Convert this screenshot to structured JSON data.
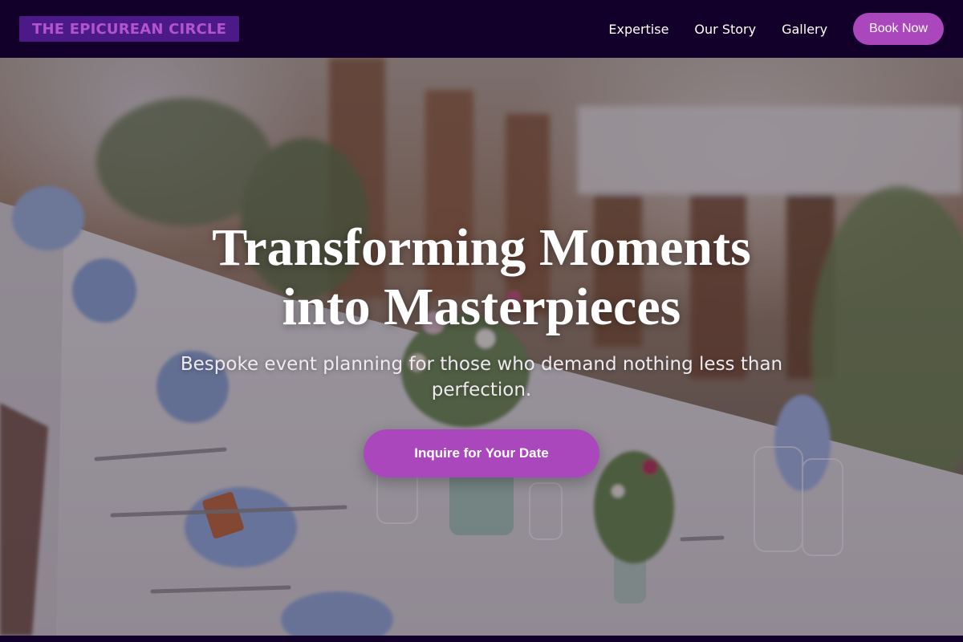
{
  "brand": {
    "name": "THE EPICUREAN CIRCLE"
  },
  "nav": {
    "links": [
      "Expertise",
      "Our Story",
      "Gallery"
    ],
    "cta_label": "Book Now"
  },
  "hero": {
    "title_line_1": "Transforming Moments",
    "title_line_2": "into Masterpieces",
    "subtitle": "Bespoke event planning for those who demand nothing less than perfection.",
    "cta_label": "Inquire for Your Date",
    "background_image": "banquet-table-with-flowers"
  },
  "colors": {
    "nav_background": "#12002a",
    "accent": "#ab47bc",
    "logo_text": "#b253d2",
    "logo_background": "#4b1a86"
  }
}
